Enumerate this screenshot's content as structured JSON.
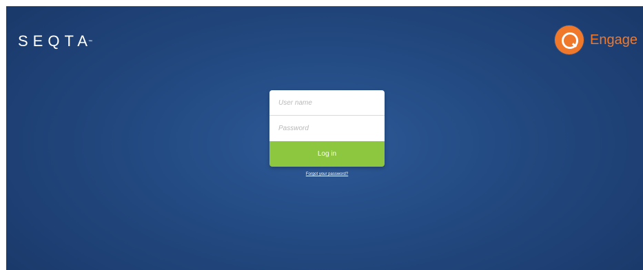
{
  "header": {
    "brand_name": "SEQTA",
    "brand_mark": "™",
    "engage_label": "Engage",
    "engage_icon": "engage-q-logo-icon"
  },
  "login": {
    "username_placeholder": "User name",
    "username_value": "",
    "password_placeholder": "Password",
    "password_value": "",
    "login_label": "Log in",
    "forgot_label": "Forgot your password?"
  },
  "colors": {
    "background_center": "#2d5a97",
    "background_edge": "#1b3a6c",
    "accent_orange": "#f0782a",
    "button_green": "#8dc63f"
  }
}
